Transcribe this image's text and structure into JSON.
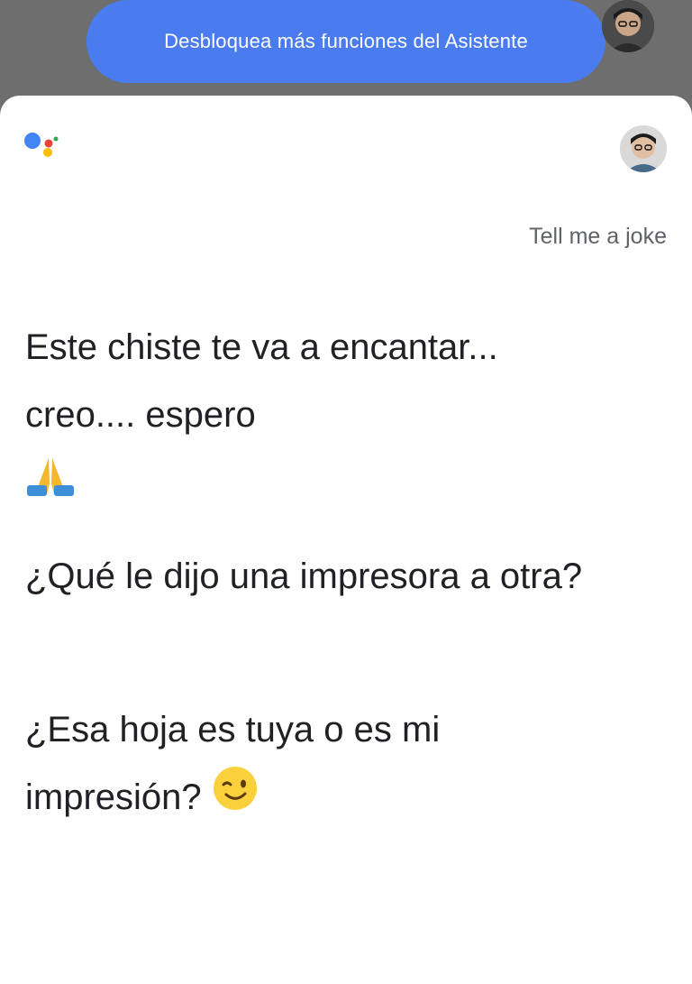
{
  "banner": {
    "label": "Desbloquea más funciones del Asistente"
  },
  "icons": {
    "assistant_logo": "google-assistant-icon",
    "pray_emoji": "folded-hands-emoji",
    "wink_emoji": "winking-face-emoji"
  },
  "colors": {
    "banner_blue": "#4a7cf0",
    "logo_blue": "#4285F4",
    "logo_red": "#EA4335",
    "logo_yellow": "#FBBC05",
    "logo_green": "#34A853"
  },
  "conversation": {
    "user_query": "Tell me a joke",
    "responses": [
      "Este chiste te va a encantar... creo.... espero",
      "¿Qué le dijo una impresora a otra?",
      "¿Esa hoja es tuya o es mi impresión?"
    ]
  }
}
